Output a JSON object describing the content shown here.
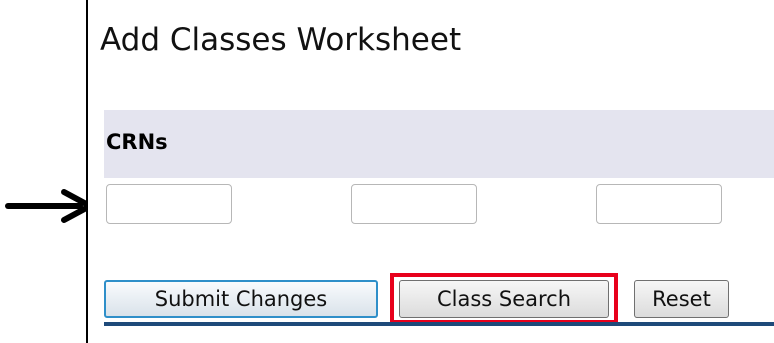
{
  "page": {
    "title": "Add Classes Worksheet"
  },
  "crns": {
    "header_label": "CRNs",
    "inputs": [
      {
        "value": ""
      },
      {
        "value": ""
      },
      {
        "value": ""
      }
    ]
  },
  "buttons": {
    "submit_label": "Submit Changes",
    "class_search_label": "Class Search",
    "reset_label": "Reset"
  },
  "annotations": {
    "arrow_icon": "right-arrow-icon",
    "highlight_color": "#e8001c"
  },
  "colors": {
    "header_bg": "#e4e4ef",
    "submit_border": "#2f8fc9",
    "bottom_rule": "#1e4a7a"
  }
}
